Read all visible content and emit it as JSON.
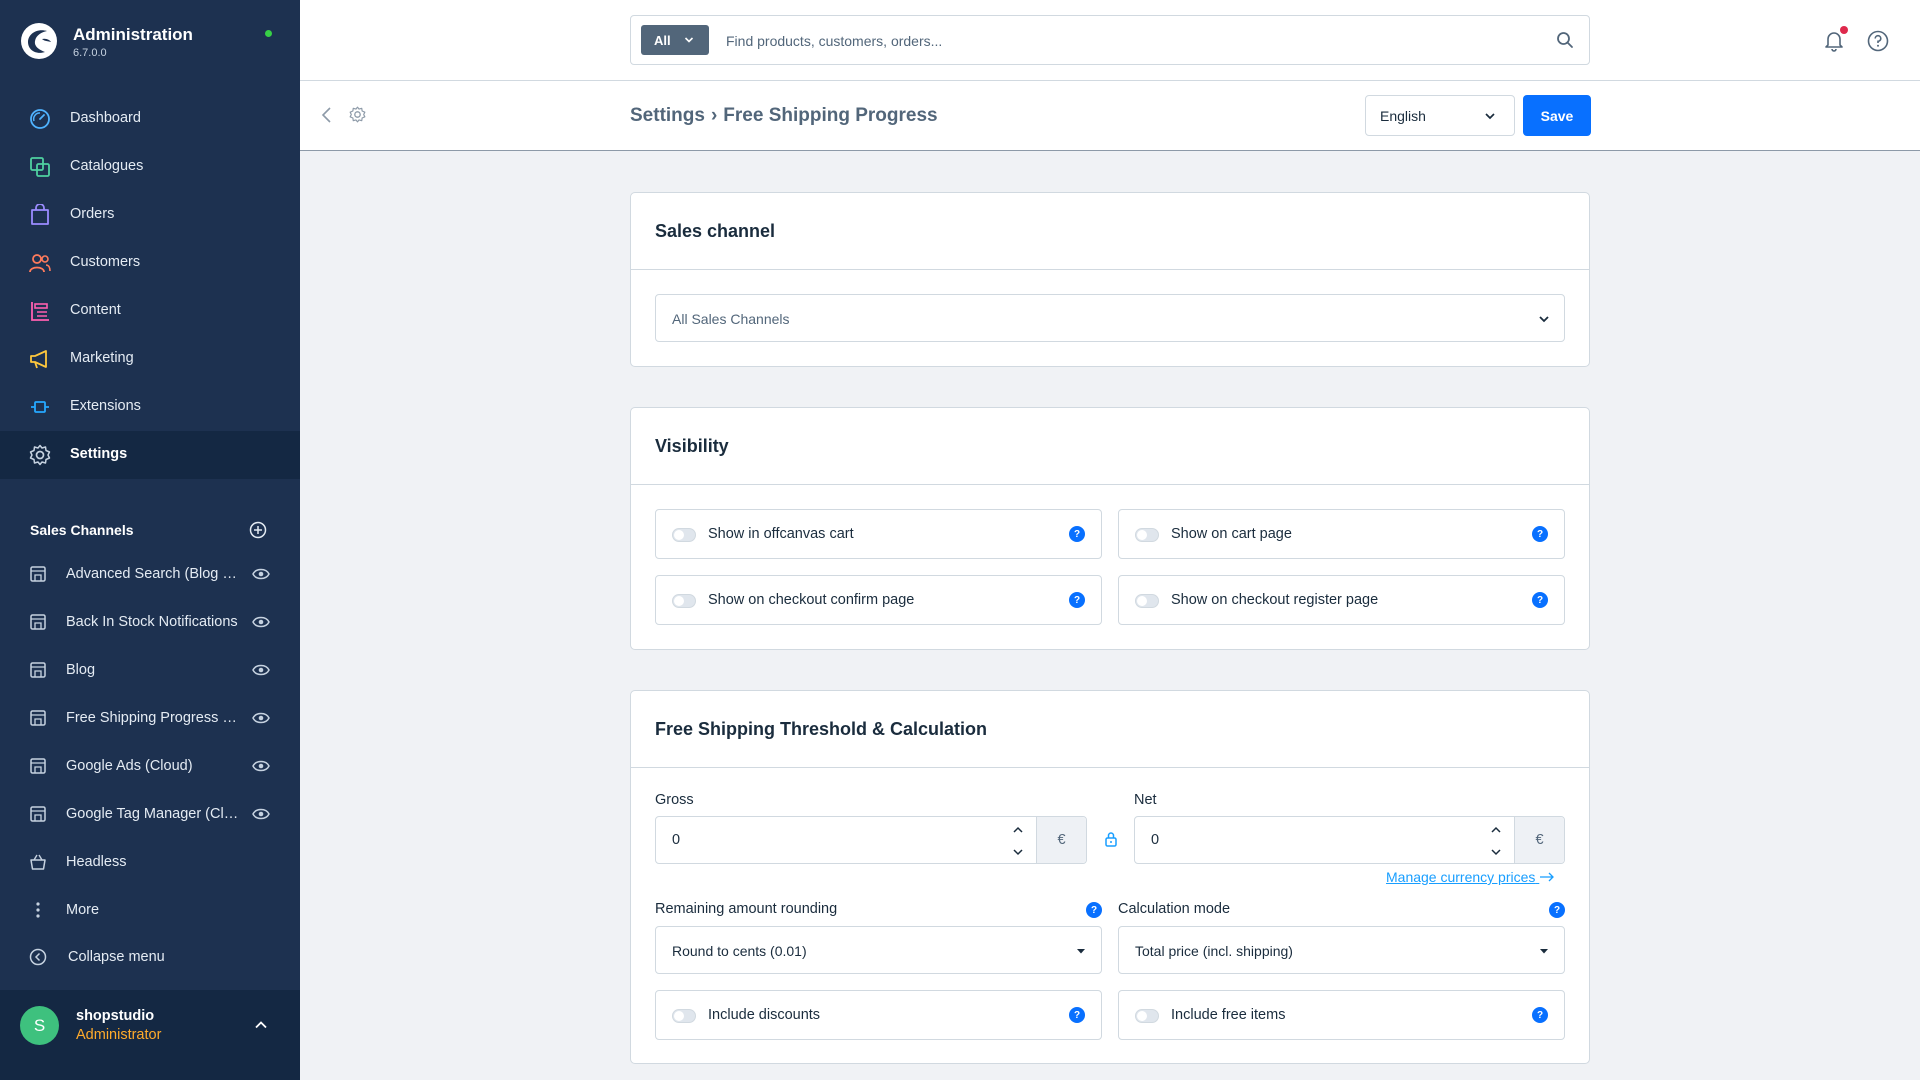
{
  "app": {
    "title": "Administration",
    "version": "6.7.0.0"
  },
  "sidebar": {
    "nav": [
      {
        "label": "Dashboard",
        "icon": "dashboard-icon"
      },
      {
        "label": "Catalogues",
        "icon": "catalogues-icon"
      },
      {
        "label": "Orders",
        "icon": "orders-icon"
      },
      {
        "label": "Customers",
        "icon": "customers-icon"
      },
      {
        "label": "Content",
        "icon": "content-icon"
      },
      {
        "label": "Marketing",
        "icon": "marketing-icon"
      },
      {
        "label": "Extensions",
        "icon": "extensions-icon"
      },
      {
        "label": "Settings",
        "icon": "settings-icon"
      }
    ],
    "sales_channels_header": "Sales Channels",
    "sales_channels": [
      "Advanced Search (Blog + Wishlist)",
      "Back In Stock Notifications",
      "Blog",
      "Free Shipping Progress Bar",
      "Google Ads (Cloud)",
      "Google Tag Manager (Cloud)",
      "Headless"
    ],
    "more_label": "More",
    "collapse_label": "Collapse menu",
    "user": {
      "initial": "S",
      "name": "shopstudio",
      "role": "Administrator"
    }
  },
  "search": {
    "type_label": "All",
    "placeholder": "Find products, customers, orders..."
  },
  "header": {
    "breadcrumb_parent": "Settings",
    "breadcrumb_separator": "›",
    "breadcrumb_current": "Free Shipping Progress",
    "language": "English",
    "save_label": "Save"
  },
  "sales_channel_card": {
    "title": "Sales channel",
    "selected": "All Sales Channels"
  },
  "visibility_card": {
    "title": "Visibility",
    "switches": [
      {
        "label": "Show in offcanvas cart",
        "checked": false
      },
      {
        "label": "Show on cart page",
        "checked": false
      },
      {
        "label": "Show on checkout confirm page",
        "checked": false
      },
      {
        "label": "Show on checkout register page",
        "checked": false
      }
    ]
  },
  "threshold_card": {
    "title": "Free Shipping Threshold & Calculation",
    "gross_label": "Gross",
    "gross_value": "0",
    "net_label": "Net",
    "net_value": "0",
    "currency": "€",
    "manage_link": "Manage currency prices",
    "rounding_label": "Remaining amount rounding",
    "rounding_value": "Round to cents (0.01)",
    "calc_mode_label": "Calculation mode",
    "calc_mode_value": "Total price (incl. shipping)",
    "include_discounts": "Include discounts",
    "include_free_items": "Include free items"
  },
  "colors": {
    "sidebar_bg": "#1d3150",
    "accent": "#0870ff",
    "link": "#189eff",
    "online": "#37d046",
    "role": "#ffab2b"
  }
}
